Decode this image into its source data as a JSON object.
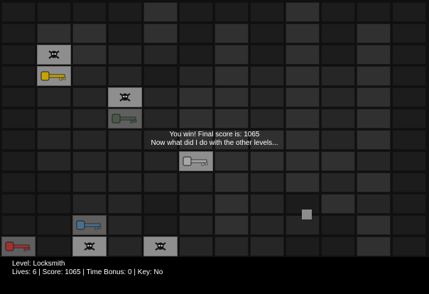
{
  "message": {
    "line1": "You win! Final score is: 1065",
    "line2": "Now what did I do with the other levels..."
  },
  "status": {
    "level_line": "Level: Locksmith",
    "stats_line": "Lives: 6 | Score: 1065 | Time Bonus: 0 | Key: No"
  },
  "items": [
    {
      "name": "skull-icon",
      "kind": "skull"
    },
    {
      "name": "yellow-key-icon",
      "kind": "key",
      "color": "#c7a400"
    },
    {
      "name": "skull-icon",
      "kind": "skull"
    },
    {
      "name": "dark-key-icon",
      "kind": "key",
      "color": "#4a5a4a"
    },
    {
      "name": "silver-key-icon",
      "kind": "key",
      "color": "#a8a8a8"
    },
    {
      "name": "blue-key-icon",
      "kind": "key",
      "color": "#4a6f8c"
    },
    {
      "name": "red-key-icon",
      "kind": "key",
      "color": "#a33030"
    },
    {
      "name": "skull-icon",
      "kind": "skull"
    },
    {
      "name": "skull-icon",
      "kind": "skull"
    }
  ],
  "colors": {
    "yellow_key": "#c7a400",
    "red_key": "#a33030",
    "blue_key": "#4a6f8c",
    "player": "#8c8c8c"
  }
}
